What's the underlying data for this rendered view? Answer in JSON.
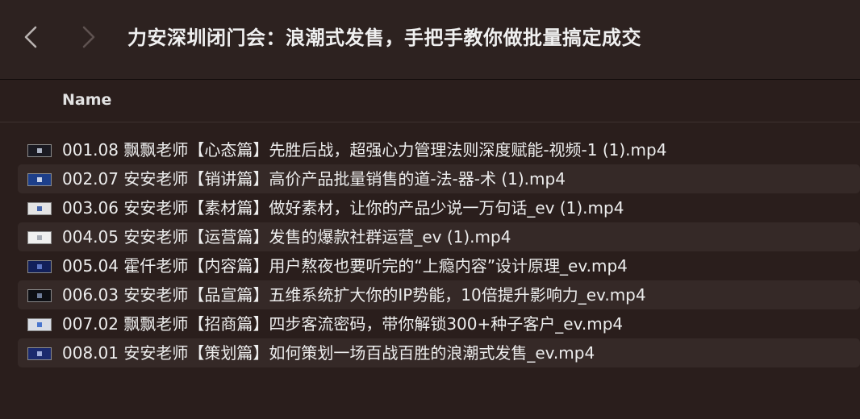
{
  "window": {
    "title": "力安深圳闭门会：浪潮式发售，手把手教你做批量搞定成交"
  },
  "toolbar": {
    "back_icon": "chevron-left-icon",
    "forward_icon": "chevron-right-icon"
  },
  "list": {
    "column_name": "Name",
    "files": [
      {
        "name": "001.08 飘飘老师【心态篇】先胜后战，超强心力管理法则深度赋能-视频-1 (1).mp4",
        "thumb_color": "#1a1a22",
        "mark_color": "#c8d0e0"
      },
      {
        "name": "002.07 安安老师【销讲篇】高价产品批量销售的道-法-器-术 (1).mp4",
        "thumb_color": "#1d3f8a",
        "mark_color": "#e8eefc"
      },
      {
        "name": "003.06 安安老师【素材篇】做好素材，让你的产品少说一万句话_ev (1).mp4",
        "thumb_color": "#e4e4e4",
        "mark_color": "#2a4fa0"
      },
      {
        "name": "004.05 安安老师【运营篇】发售的爆款社群运营_ev (1).mp4",
        "thumb_color": "#f0f0f0",
        "mark_color": "#9aa0aa"
      },
      {
        "name": "005.04 霍仟老师【内容篇】用户熬夜也要听完的“上瘾内容”设计原理_ev.mp4",
        "thumb_color": "#12205a",
        "mark_color": "#6b86d6"
      },
      {
        "name": "006.03 安安老师【品宣篇】五维系统扩大你的IP势能，10倍提升影响力_ev.mp4",
        "thumb_color": "#0d0f14",
        "mark_color": "#8090b0"
      },
      {
        "name": "007.02 飘飘老师【招商篇】四步客流密码，带你解锁300+种子客户_ev.mp4",
        "thumb_color": "#d9dde6",
        "mark_color": "#2f63c8"
      },
      {
        "name": "008.01 安安老师【策划篇】如何策划一场百战百胜的浪潮式发售_ev.mp4",
        "thumb_color": "#1b2a6e",
        "mark_color": "#b9c6f0"
      }
    ]
  },
  "colors": {
    "background": "#2a1e1c",
    "alt_row": "#352927",
    "text": "#ededed"
  }
}
